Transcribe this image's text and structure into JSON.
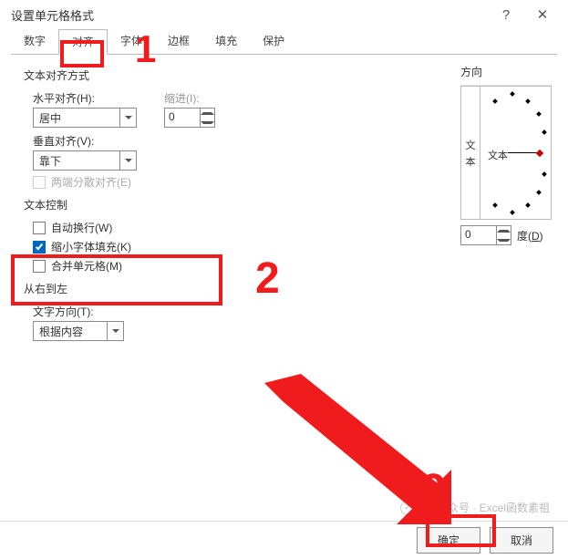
{
  "title": "设置单元格格式",
  "titlebar": {
    "help": "?",
    "close": "✕"
  },
  "tabs": [
    "数字",
    "对齐",
    "字体",
    "边框",
    "填充",
    "保护"
  ],
  "active_tab_index": 1,
  "groups": {
    "text_align": "文本对齐方式",
    "text_control": "文本控制",
    "rtl": "从右到左",
    "orientation": "方向"
  },
  "fields": {
    "halign_label": "水平对齐(H):",
    "halign_value": "居中",
    "indent_label": "缩进(I):",
    "indent_value": "0",
    "valign_label": "垂直对齐(V):",
    "valign_value": "靠下",
    "justify_label": "两端分散对齐(E)",
    "wrap_label": "自动换行(W)",
    "shrink_label": "缩小字体填充(K)",
    "merge_label": "合并单元格(M)",
    "text_dir_label": "文字方向(T):",
    "text_dir_value": "根据内容",
    "orient_vert": [
      "文",
      "本"
    ],
    "orient_dial_label": "文本",
    "degree_value": "0",
    "degree_label_pre": "度(",
    "degree_label_u": "D",
    "degree_label_suf": ")"
  },
  "checkstate": {
    "justify": false,
    "wrap": false,
    "shrink": true,
    "merge": false
  },
  "buttons": {
    "ok": "确定",
    "cancel": "取消"
  },
  "annotations": {
    "n1": "1",
    "n2": "2",
    "n3": "3"
  },
  "watermark": "公众号 · Excel函数素祖"
}
